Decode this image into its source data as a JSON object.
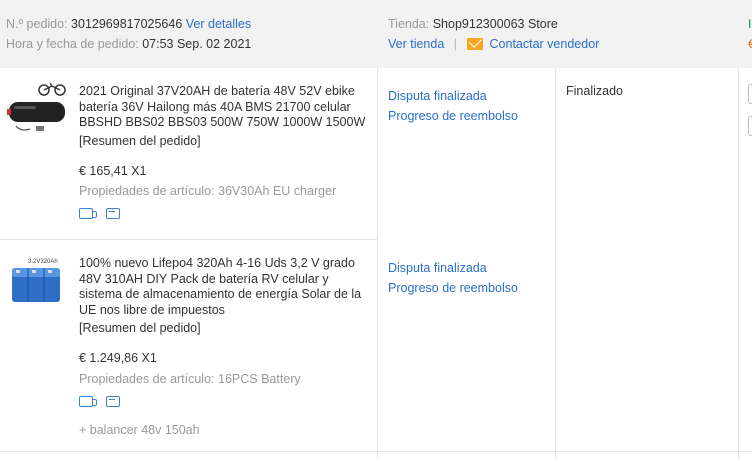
{
  "order": {
    "number_label": "N.º pedido:",
    "number": "3012969817025646",
    "details_link": "Ver detalles",
    "datetime_label": "Hora y fecha de pedido:",
    "datetime": "07:53 Sep. 02 2021",
    "store_label": "Tienda:",
    "store_name": "Shop912300063 Store",
    "view_store": "Ver tienda",
    "separator": "|",
    "contact_seller": "Contactar vendedor",
    "status": "Finalizado"
  },
  "items": [
    {
      "title": "2021 Original 37V20AH de batería 48V 52V ebike batería 36V Hailong más 40A BMS 21700 celular BBSHD BBS02 BBS03 500W 750W 1000W 1500W",
      "summary_link": "[Resumen del pedido]",
      "price": "€ 165,41 X1",
      "props_label": "Propiedades de artículo:",
      "props_value": "36V30Ah EU charger",
      "dispute": "Disputa finalizada",
      "refund": "Progreso de reembolso"
    },
    {
      "title": "100% nuevo Lifepo4 320Ah 4-16 Uds 3,2 V grado 48V 310AH DIY Pack de batería RV celular y sistema de almacenamiento de energía Solar de la UE nos libre de impuestos",
      "summary_link": "[Resumen del pedido]",
      "price": "€ 1.249,86 X1",
      "props_label": "Propiedades de artículo:",
      "props_value": "16PCS Battery",
      "extra": "+ balancer 48v 150ah",
      "dispute": "Disputa finalizada",
      "refund": "Progreso de reembolso",
      "thumb_label": "3.2V320Ah"
    }
  ],
  "colors": {
    "link": "#2b6fc8",
    "accent_orange": "#f5a623",
    "header_bg": "#f2f2f2"
  }
}
